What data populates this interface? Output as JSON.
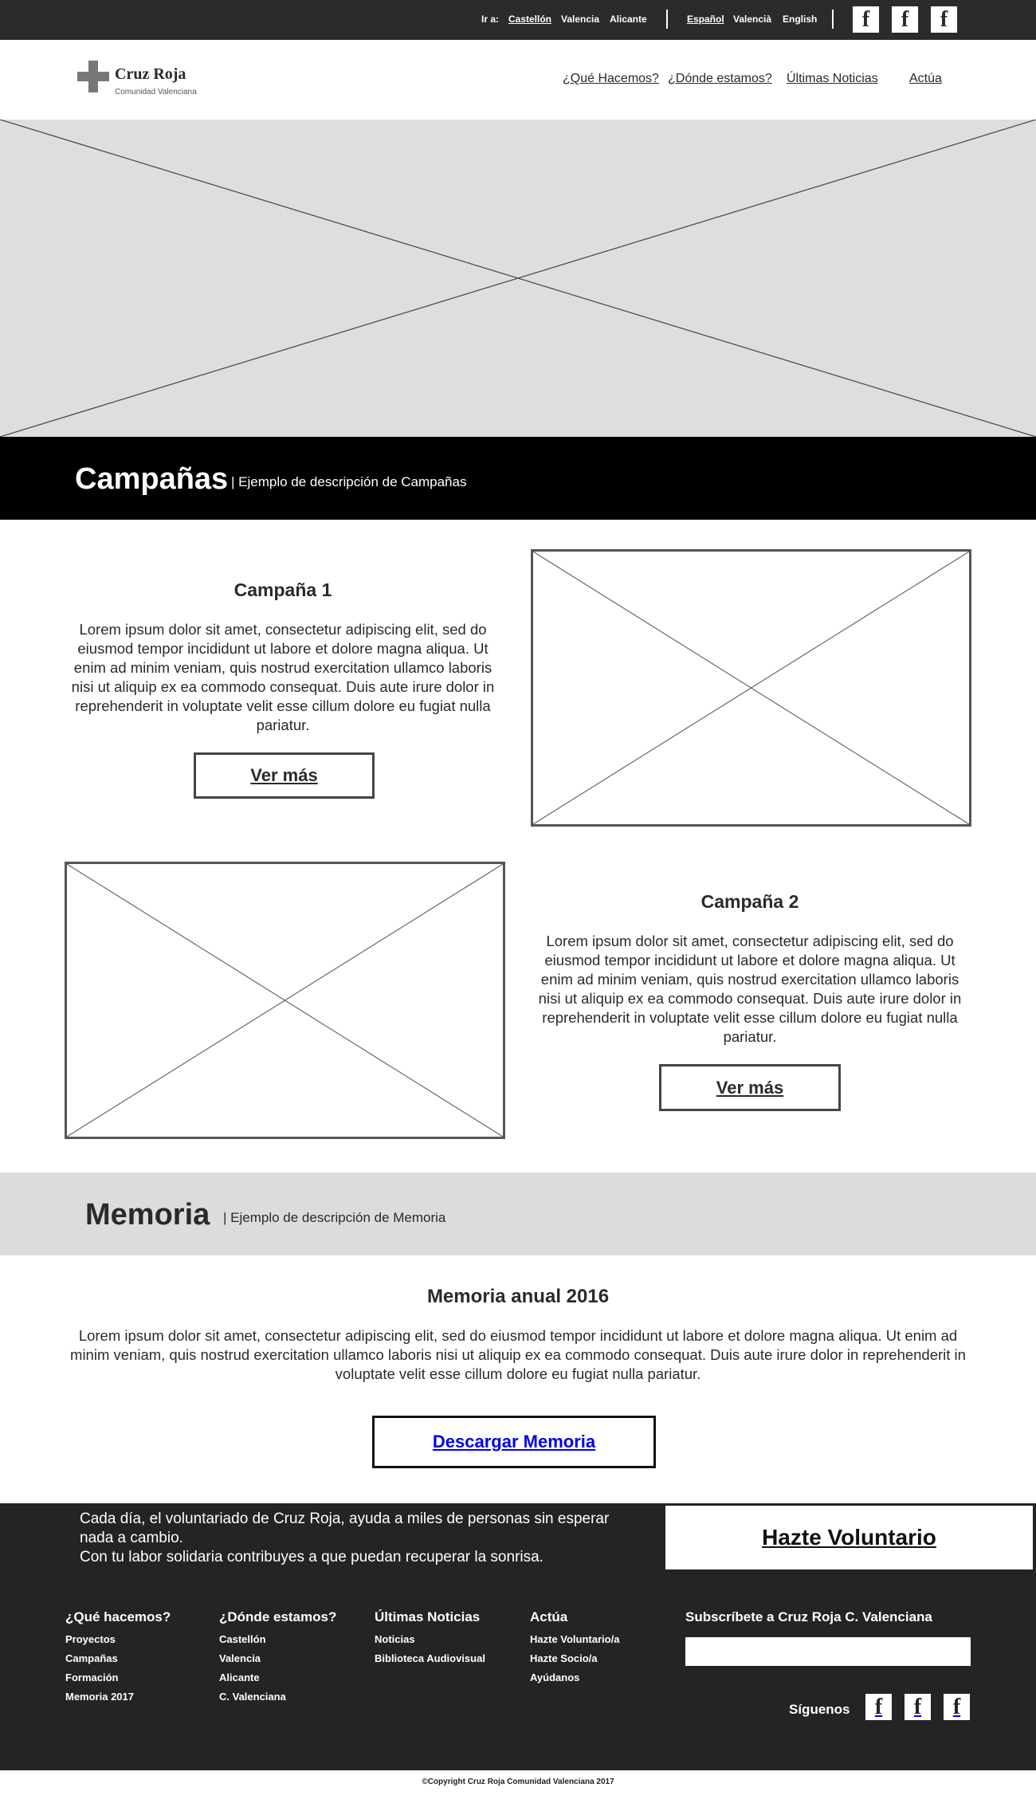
{
  "topbar": {
    "goto_label": "Ir a:",
    "cities": [
      "Castellón",
      "Valencia",
      "Alicante"
    ],
    "languages": [
      "Español",
      "Valencià",
      "English"
    ],
    "social_icon": "facebook-icon"
  },
  "header": {
    "logo_name": "Cruz Roja",
    "logo_sub": "Comunidad Valenciana",
    "nav": [
      "¿Qué Hacemos?",
      "¿Dónde estamos?",
      "Últimas Noticias",
      "Actúa"
    ]
  },
  "campaigns_banner": {
    "title": "Campañas",
    "description": "| Ejemplo de descripción de Campañas"
  },
  "campaigns": [
    {
      "title": "Campaña 1",
      "text": "Lorem ipsum dolor sit amet, consectetur adipiscing elit, sed do eiusmod tempor incididunt ut labore et dolore magna aliqua. Ut enim ad minim veniam, quis nostrud exercitation ullamco laboris nisi ut aliquip ex ea commodo consequat. Duis aute irure dolor in reprehenderit in voluptate velit esse cillum dolore eu fugiat nulla pariatur.",
      "button": "Ver más"
    },
    {
      "title": "Campaña 2",
      "text": "Lorem ipsum dolor sit amet, consectetur adipiscing elit, sed do eiusmod tempor incididunt ut labore et dolore magna aliqua. Ut enim ad minim veniam, quis nostrud exercitation ullamco laboris nisi ut aliquip ex ea commodo consequat. Duis aute irure dolor in reprehenderit in voluptate velit esse cillum dolore eu fugiat nulla pariatur.",
      "button": "Ver más"
    }
  ],
  "memoria_banner": {
    "title": "Memoria",
    "description": "| Ejemplo de descripción de Memoria"
  },
  "memoria": {
    "title": "Memoria anual 2016",
    "text": "Lorem ipsum dolor sit amet, consectetur adipiscing elit, sed do eiusmod tempor incididunt ut labore et dolore magna aliqua. Ut enim ad minim veniam, quis nostrud exercitation ullamco laboris nisi ut aliquip ex ea commodo consequat. Duis aute irure dolor in reprehenderit in voluptate velit esse cillum dolore eu fugiat nulla pariatur.",
    "button": "Descargar Memoria"
  },
  "footer": {
    "cta_line1": "Cada día, el voluntariado de Cruz Roja, ayuda a miles de personas sin esperar nada a cambio.",
    "cta_line2": "Con tu labor solidaria contribuyes a que puedan recuperar la sonrisa.",
    "cta_button": "Hazte Voluntario",
    "columns": [
      {
        "title": "¿Qué hacemos?",
        "links": [
          "Proyectos",
          "Campañas",
          "Formación",
          "Memoria 2017"
        ]
      },
      {
        "title": "¿Dónde estamos?",
        "links": [
          "Castellón",
          "Valencia",
          "Alicante",
          "C. Valenciana"
        ]
      },
      {
        "title": "Últimas Noticias",
        "links": [
          "Noticias",
          "Biblioteca Audiovisual"
        ]
      },
      {
        "title": "Actúa",
        "links": [
          "Hazte Voluntario/a",
          "Hazte Socio/a",
          "Ayúdanos"
        ]
      }
    ],
    "subscribe_title": "Subscríbete a Cruz Roja C. Valenciana",
    "follow_label": "Síguenos"
  },
  "copyright": "©Copyright Cruz Roja Comunidad Valenciana 2017"
}
